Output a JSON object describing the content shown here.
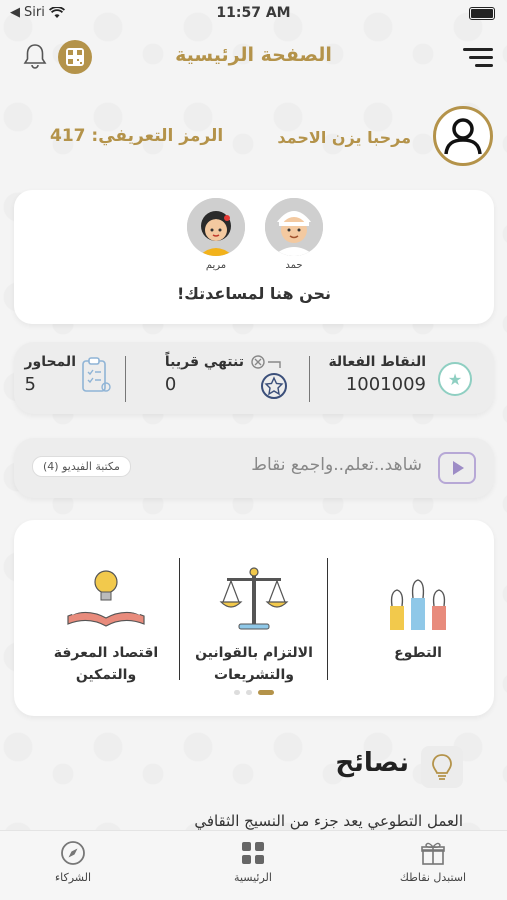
{
  "status_bar": {
    "carrier": "Siri",
    "time": "11:57 AM"
  },
  "header": {
    "title": "الصفحة الرئيسية"
  },
  "user": {
    "greeting": "مرحبا يزن الاحمد",
    "id_code": "الرمز التعريفي: 417"
  },
  "help": {
    "kids": [
      {
        "name": "حمد"
      },
      {
        "name": "مريم"
      }
    ],
    "text": "نحن هنا لمساعدتك!"
  },
  "stats": {
    "active_points_label": "النقاط الفعالة",
    "active_points_value": "1001009",
    "expiring_label": "تنتهي قريباً",
    "expiring_value": "0",
    "topics_label": "المحاور",
    "topics_value": "5"
  },
  "video": {
    "title": "شاهد..تعلم..واجمع نقاط",
    "library_label": "مكتبة الفيديو (4)"
  },
  "categories": [
    {
      "label": "التطوع",
      "icon": "hands-raised-icon"
    },
    {
      "label": "الالتزام بالقوانين والتشريعات",
      "icon": "scales-icon"
    },
    {
      "label": "اقتصاد المعرفة والتمكين",
      "icon": "lightbulb-book-icon"
    }
  ],
  "tips": {
    "title": "نصائح",
    "text": "العمل التطوعي يعد جزء من النسيج الثقافي"
  },
  "bottom_nav": [
    {
      "label": "استبدل نقاطك",
      "icon": "gift-icon"
    },
    {
      "label": "الرئيسية",
      "icon": "grid-icon"
    },
    {
      "label": "الشركاء",
      "icon": "compass-icon"
    }
  ],
  "colors": {
    "gold": "#b4934a",
    "teal": "#8fcfc2",
    "purple": "#9d8cc6"
  }
}
